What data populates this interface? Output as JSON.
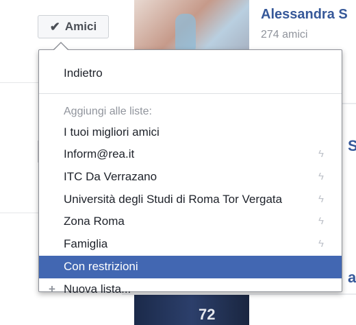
{
  "profile_card": {
    "name": "Alessandra S",
    "friend_count": "274 amici"
  },
  "peek_letters": [
    "S",
    "ar"
  ],
  "photo2_number": "72",
  "friends_button": {
    "label": "Amici",
    "icon": "check-icon"
  },
  "menu": {
    "back_label": "Indietro",
    "lists_heading": "Aggiungi alle liste:",
    "items": [
      {
        "label": "I tuoi migliori amici",
        "icon": ""
      },
      {
        "label": "Inform@rea.it",
        "icon": "bolt-icon"
      },
      {
        "label": "ITC Da Verrazano",
        "icon": "bolt-icon"
      },
      {
        "label": "Università degli Studi di Roma Tor Vergata",
        "icon": "bolt-icon"
      },
      {
        "label": "Zona Roma",
        "icon": "bolt-icon"
      },
      {
        "label": "Famiglia",
        "icon": "bolt-icon"
      },
      {
        "label": "Con restrizioni",
        "icon": ""
      }
    ],
    "new_list_label": "Nuova lista..."
  },
  "colors": {
    "accent": "#4267b2",
    "link": "#365899"
  }
}
